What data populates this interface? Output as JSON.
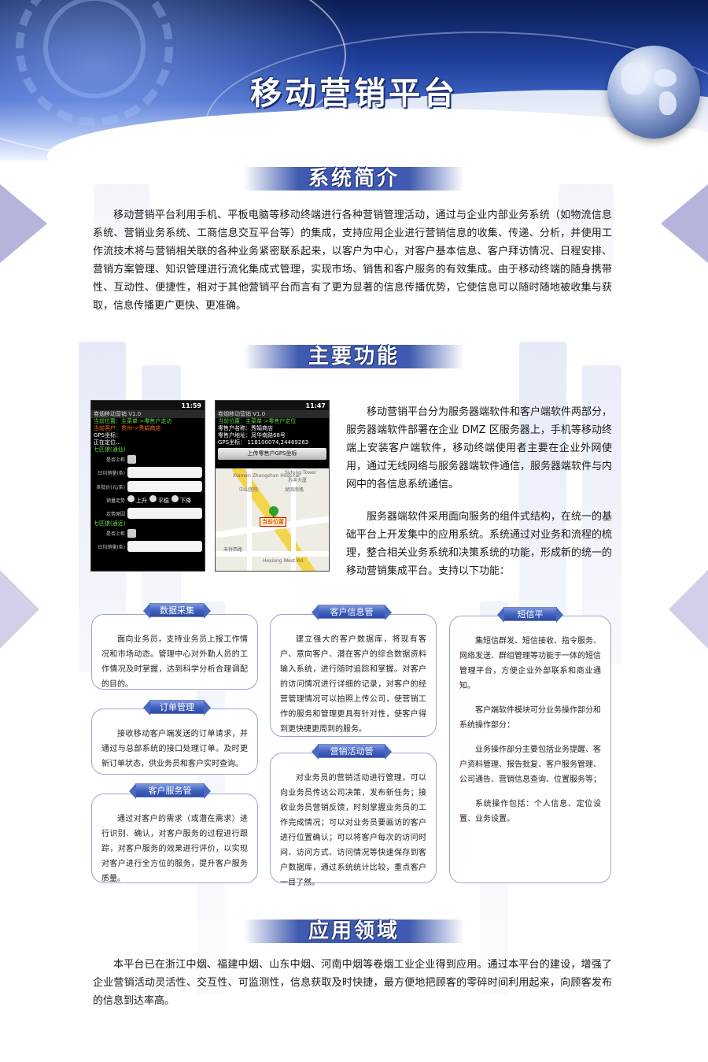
{
  "header": {
    "title": "移动营销平台"
  },
  "sections": {
    "intro": {
      "heading": "系统简介",
      "text": "移动营销平台利用手机、平板电脑等移动终端进行各种营销管理活动，通过与企业内部业务系统（如物流信息系统、营销业务系统、工商信息交互平台等）的集成，支持应用企业进行营销信息的收集、传递、分析，并使用工作流技术将与营销相关联的各种业务紧密联系起来，以客户为中心，对客户基本信息、客户拜访情况、日程安排、营销方案管理、知识管理进行流化集成式管理，实现市场、销售和客户服务的有效集成。由于移动终端的随身携带性、互动性、便捷性，相对于其他营销平台而言有了更为显著的信息传播优势，它使信息可以随时随地被收集与获取，信息传播更广更快、更准确。"
    },
    "functions": {
      "heading": "主要功能",
      "para1": "移动营销平台分为服务器端软件和客户端软件两部分，服务器端软件部署在企业 DMZ 区服务器上，手机等移动终端上安装客户端软件，移动终端使用者主要在企业外网使用，通过无线网络与服务器端软件通信，服务器端软件与内网中的各信息系统通信。",
      "para2": "服务器端软件采用面向服务的组件式结构，在统一的基础平台上开发集中的应用系统。系统通过对业务和流程的梳理，整合相关业务系统和决策系统的功能，形成新的统一的移动营销集成平台。支持以下功能："
    },
    "application": {
      "heading": "应用领域",
      "text": "本平台已在浙江中烟、福建中烟、山东中烟、河南中烟等卷烟工业企业得到应用。通过本平台的建设，增强了企业营销活动灵活性、交互性、可监测性，信息获取及时快捷，最方便地把顾客的零碎时间利用起来，向顾客发布的信息到达率高。"
    }
  },
  "phone1": {
    "time": "11:59",
    "title": "卷烟移动营销 V1.0",
    "location": "当前位置：主菜单->零售户走访",
    "customer": "当前客户：贵州->秀娟商店",
    "gps": "GPS坐标：",
    "locating": "正在定位...",
    "group1": "七匹狼(通仙)",
    "row_shelf": "是否上柜",
    "row_daily": "日均销量(条)",
    "row_price": "条批价(元/条)",
    "row_trend": "销量走势",
    "opt_up": "上升",
    "opt_flat": "平稳",
    "opt_down": "下降",
    "row_reason": "走势原因",
    "group2": "七匹狼(通远)",
    "row_shelf2": "是否上柜",
    "row_daily2": "日均销量(条)"
  },
  "phone2": {
    "time": "11:47",
    "title": "卷烟移动营销 V1.0",
    "location": "当前位置：主菜单->零售户定位",
    "name": "零售户名称：秀娟商店",
    "address": "零售户地址：凤华南路68号",
    "gps": "GPS坐标：  118100074,24469263",
    "upload": "上传零售户GPS坐标",
    "pin_label": "当前位置",
    "map_labels": [
      "Xiamen Zhongshan Hospital",
      "中山医院",
      "Sufeng Tower",
      "苏丰大厦",
      "Hubin South Rd",
      "湖滨南路",
      "Hubin Middle Rd",
      "Heyuan Rd",
      "禾祥西路",
      "Hexiang West Rd"
    ]
  },
  "features": {
    "data_collect": {
      "tag": "数据采集",
      "text": "面向业务员，支持业务员上报工作情况和市场动态。管理中心对外勤人员的工作情况及时掌握，达到科学分析合理调配的目的。"
    },
    "orders": {
      "tag": "订单管理",
      "text": "接收移动客户端发送的订单请求，并通过与总部系统的接口处理订单。及时更新订单状态，供业务员和客户实时查询。"
    },
    "service": {
      "tag": "客户服务管理",
      "text": "通过对客户的需求（或潜在需求）进行识别、确认，对客户服务的过程进行跟踪，对客户服务的效果进行评价，以实现对客户进行全方位的服务，提升客户服务质量。"
    },
    "customer_info": {
      "tag": "客户信息管理",
      "text": "建立强大的客户数据库，将现有客户、意向客户、潜在客户的综合数据资料输入系统，进行随时追踪和掌握。对客户的访问情况进行详细的记录，对客户的经营管理情况可以拍照上传公司，使营销工作的服务和管理更具有针对性，使客户得到更快捷更周到的服务。"
    },
    "marketing": {
      "tag": "营销活动管理",
      "text": "对业务员的营销活动进行管理，可以向业务员传达公司决策，发布新任务；接收业务员营销反馈，时刻掌握业务员的工作完成情况；可以对业务员要画访的客户进行位置确认；可以将客户每次的访问时间、访问方式、访问情况等快速保存到客户数据库，通过系统统计比较，重点客户一目了然。"
    },
    "sms": {
      "tag": "短信平台",
      "p1": "集短信群发、短信接收、指令服务、网络发送、群组管理等功能于一体的短信管理平台，方便企业外部联系和商业通知。",
      "p2": "客户端软件模块可分业务操作部分和系统操作部分：",
      "p3": "业务操作部分主要包括业务提醒、客户资料管理、报告批复、客户服务管理、公司通告、营销信息查询、位置服务等；",
      "p4": "系统操作包括：个人信息、定位设置、业务设置。"
    }
  }
}
